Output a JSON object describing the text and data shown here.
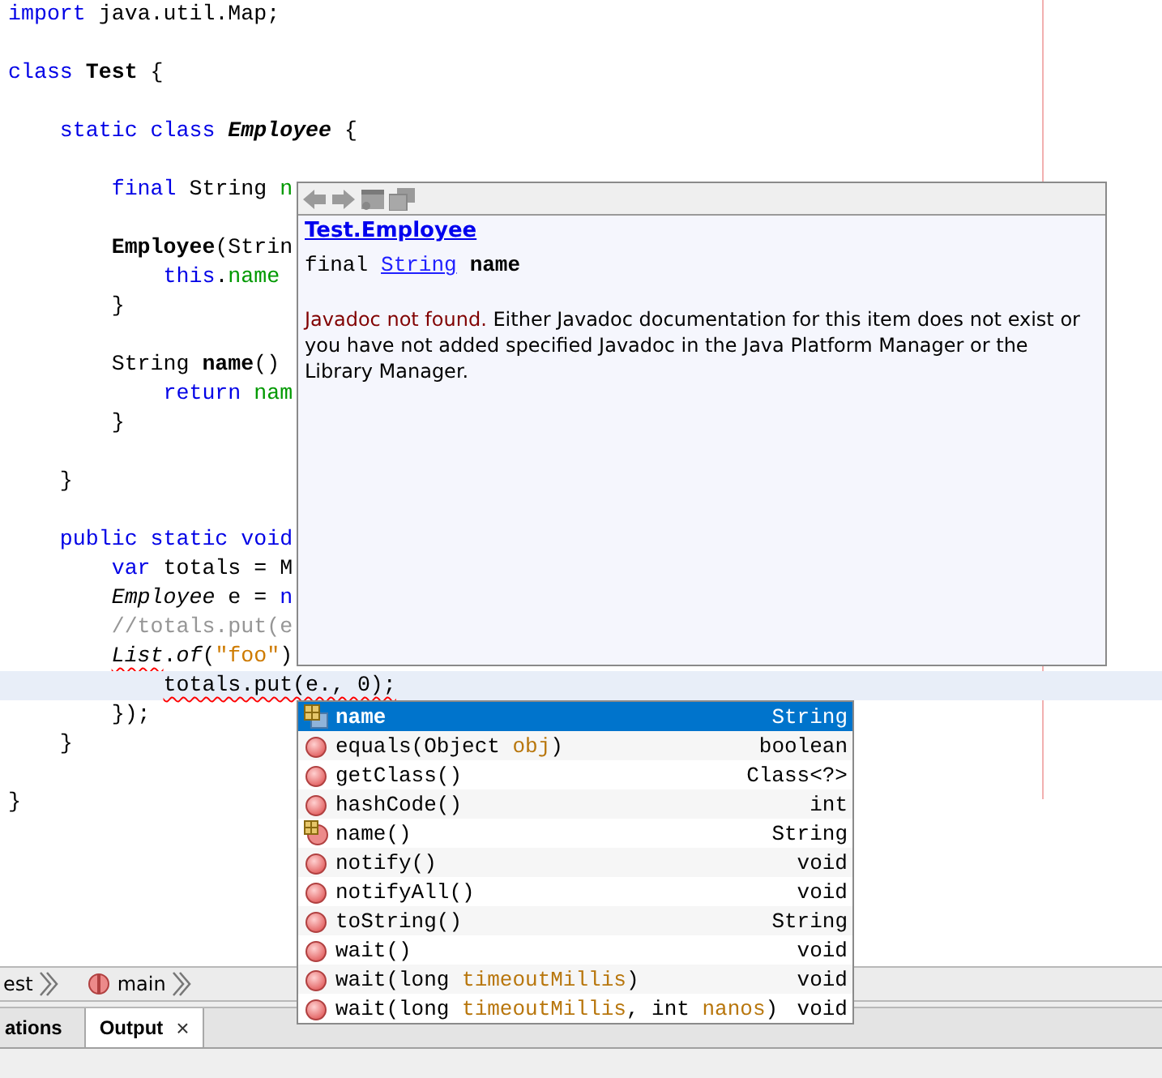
{
  "editor": {
    "lines": [
      {
        "kind": "code",
        "current": false,
        "tokens": [
          {
            "kind": "kw",
            "text": "import"
          },
          {
            "kind": "plain",
            "text": " java.util.Map;"
          }
        ]
      },
      {
        "kind": "blank"
      },
      {
        "kind": "code",
        "current": false,
        "tokens": [
          {
            "kind": "kw",
            "text": "class"
          },
          {
            "kind": "bold",
            "text": " Test"
          },
          {
            "kind": "plain",
            "text": " {"
          }
        ]
      },
      {
        "kind": "blank"
      },
      {
        "kind": "code",
        "current": false,
        "tokens": [
          {
            "kind": "kw",
            "text": "    static class"
          },
          {
            "kind": "bold-italic",
            "text": " Employee"
          },
          {
            "kind": "plain",
            "text": " {"
          }
        ]
      },
      {
        "kind": "blank"
      },
      {
        "kind": "code",
        "current": false,
        "tokens": [
          {
            "kind": "kw",
            "text": "        final"
          },
          {
            "kind": "plain",
            "text": " String "
          },
          {
            "kind": "field",
            "text": "n"
          }
        ]
      },
      {
        "kind": "blank"
      },
      {
        "kind": "code",
        "current": false,
        "tokens": [
          {
            "kind": "bold",
            "text": "        Employee"
          },
          {
            "kind": "plain",
            "text": "(Strin"
          }
        ]
      },
      {
        "kind": "code",
        "current": false,
        "tokens": [
          {
            "kind": "kw",
            "text": "            this"
          },
          {
            "kind": "plain",
            "text": "."
          },
          {
            "kind": "field",
            "text": "name"
          }
        ]
      },
      {
        "kind": "code",
        "current": false,
        "tokens": [
          {
            "kind": "plain",
            "text": "        }"
          }
        ]
      },
      {
        "kind": "blank"
      },
      {
        "kind": "code",
        "current": false,
        "tokens": [
          {
            "kind": "plain",
            "text": "        String "
          },
          {
            "kind": "bold",
            "text": "name"
          },
          {
            "kind": "plain",
            "text": "()"
          }
        ]
      },
      {
        "kind": "code",
        "current": false,
        "tokens": [
          {
            "kind": "kw",
            "text": "            return"
          },
          {
            "kind": "field",
            "text": " nam"
          }
        ]
      },
      {
        "kind": "code",
        "current": false,
        "tokens": [
          {
            "kind": "plain",
            "text": "        }"
          }
        ]
      },
      {
        "kind": "blank"
      },
      {
        "kind": "code",
        "current": false,
        "tokens": [
          {
            "kind": "plain",
            "text": "    }"
          }
        ]
      },
      {
        "kind": "blank"
      },
      {
        "kind": "code",
        "current": false,
        "tokens": [
          {
            "kind": "kw",
            "text": "    public static void"
          }
        ]
      },
      {
        "kind": "code",
        "current": false,
        "tokens": [
          {
            "kind": "kw",
            "text": "        var"
          },
          {
            "kind": "plain",
            "text": " totals = M"
          }
        ]
      },
      {
        "kind": "code",
        "current": false,
        "tokens": [
          {
            "kind": "italic",
            "text": "        Employee"
          },
          {
            "kind": "plain",
            "text": " e = "
          },
          {
            "kind": "kw",
            "text": "n"
          }
        ]
      },
      {
        "kind": "code",
        "current": false,
        "tokens": [
          {
            "kind": "comment",
            "text": "        //totals.put(e"
          }
        ]
      },
      {
        "kind": "code",
        "current": false,
        "tokens": [
          {
            "kind": "italic-error",
            "text": "        List"
          },
          {
            "kind": "plain",
            "text": "."
          },
          {
            "kind": "italic",
            "text": "of"
          },
          {
            "kind": "plain",
            "text": "("
          },
          {
            "kind": "string",
            "text": "\"foo\""
          },
          {
            "kind": "plain",
            "text": ")"
          }
        ]
      },
      {
        "kind": "code",
        "current": true,
        "tokens": [
          {
            "kind": "error",
            "text": "            totals.put(e., 0);"
          }
        ]
      },
      {
        "kind": "code",
        "current": false,
        "tokens": [
          {
            "kind": "plain",
            "text": "        });"
          }
        ]
      },
      {
        "kind": "code",
        "current": false,
        "tokens": [
          {
            "kind": "plain",
            "text": "    }"
          }
        ]
      },
      {
        "kind": "blank"
      },
      {
        "kind": "code",
        "current": false,
        "tokens": [
          {
            "kind": "plain",
            "text": "}"
          }
        ]
      }
    ]
  },
  "javadoc": {
    "title": "Test.Employee",
    "signature": {
      "prefix": "final",
      "type": "String",
      "name": "name"
    },
    "note": "Javadoc not found.",
    "message": "Either Javadoc documentation for this item does not exist or you have not added specified Javadoc in the Java Platform Manager or the Library Manager."
  },
  "completion": [
    {
      "kind": "field",
      "selected": true,
      "parts": [
        {
          "kind": "name",
          "text": "name"
        }
      ],
      "type": "String"
    },
    {
      "kind": "method",
      "selected": false,
      "parts": [
        {
          "kind": "name",
          "text": "equals(Object "
        },
        {
          "kind": "param",
          "text": "obj"
        },
        {
          "kind": "name",
          "text": ")"
        }
      ],
      "type": "boolean"
    },
    {
      "kind": "method",
      "selected": false,
      "parts": [
        {
          "kind": "name",
          "text": "getClass()"
        }
      ],
      "type": "Class<?>"
    },
    {
      "kind": "method",
      "selected": false,
      "parts": [
        {
          "kind": "name",
          "text": "hashCode()"
        }
      ],
      "type": "int"
    },
    {
      "kind": "accessor",
      "selected": false,
      "parts": [
        {
          "kind": "name",
          "text": "name()"
        }
      ],
      "type": "String"
    },
    {
      "kind": "method",
      "selected": false,
      "parts": [
        {
          "kind": "name",
          "text": "notify()"
        }
      ],
      "type": "void"
    },
    {
      "kind": "method",
      "selected": false,
      "parts": [
        {
          "kind": "name",
          "text": "notifyAll()"
        }
      ],
      "type": "void"
    },
    {
      "kind": "method",
      "selected": false,
      "parts": [
        {
          "kind": "name",
          "text": "toString()"
        }
      ],
      "type": "String"
    },
    {
      "kind": "method",
      "selected": false,
      "parts": [
        {
          "kind": "name",
          "text": "wait()"
        }
      ],
      "type": "void"
    },
    {
      "kind": "method",
      "selected": false,
      "parts": [
        {
          "kind": "name",
          "text": "wait(long "
        },
        {
          "kind": "param",
          "text": "timeoutMillis"
        },
        {
          "kind": "name",
          "text": ")"
        }
      ],
      "type": "void"
    },
    {
      "kind": "method",
      "selected": false,
      "parts": [
        {
          "kind": "name",
          "text": "wait(long "
        },
        {
          "kind": "param",
          "text": "timeoutMillis"
        },
        {
          "kind": "name",
          "text": ", int "
        },
        {
          "kind": "param",
          "text": "nanos"
        },
        {
          "kind": "name",
          "text": ")"
        }
      ],
      "type": "void"
    }
  ],
  "breadcrumbs": [
    {
      "kind": "class",
      "label": "est"
    },
    {
      "kind": "method",
      "label": "main"
    }
  ],
  "tabs": [
    {
      "label": "ations",
      "selected": false
    },
    {
      "label": "Output",
      "selected": true,
      "close": "×"
    }
  ]
}
